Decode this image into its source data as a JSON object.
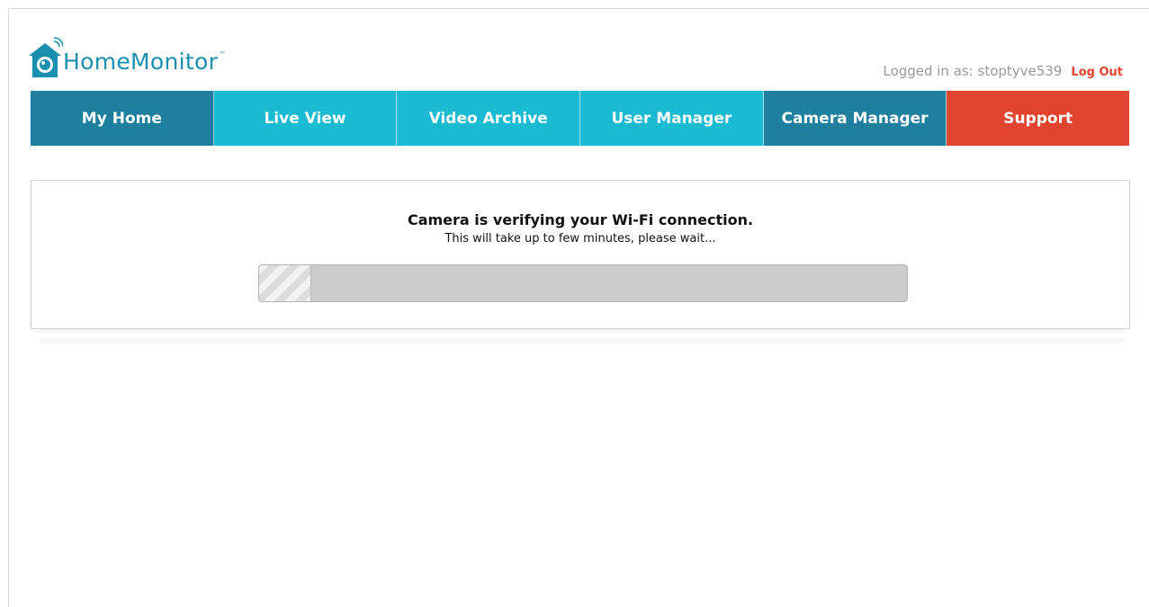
{
  "brand": {
    "name": "HomeMonitor",
    "trademark": "™",
    "icon": "home-camera-icon",
    "color": "#1a8fb0"
  },
  "user": {
    "logged_in_label": "Logged in as: stoptyve539",
    "logout_label": "Log Out"
  },
  "nav": {
    "items": [
      {
        "label": "My Home",
        "color": "#1e7f9e"
      },
      {
        "label": "Live View",
        "color": "#1bbad3"
      },
      {
        "label": "Video Archive",
        "color": "#1bbad3"
      },
      {
        "label": "User Manager",
        "color": "#1bbad3"
      },
      {
        "label": "Camera Manager",
        "color": "#1e7f9e"
      },
      {
        "label": "Support",
        "color": "#e2452f"
      }
    ]
  },
  "status": {
    "title": "Camera is verifying your Wi-Fi connection.",
    "subtitle": "This will take up to few minutes, please wait...",
    "progress_fraction": 0.08
  }
}
